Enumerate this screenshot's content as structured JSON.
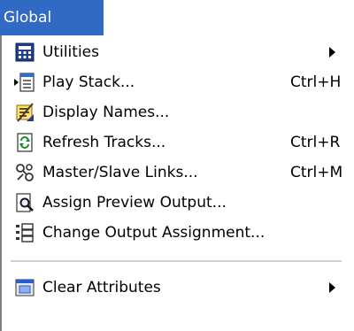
{
  "menu": {
    "title": "Global",
    "accent_color": "#316ac5",
    "items": [
      {
        "icon": "utilities-calculator-icon",
        "label": "Utilities",
        "shortcut": "",
        "has_submenu": true
      },
      {
        "icon": "play-stack-icon",
        "label": "Play Stack...",
        "shortcut": "Ctrl+H",
        "has_submenu": false
      },
      {
        "icon": "display-names-icon",
        "label": "Display Names...",
        "shortcut": "",
        "has_submenu": false
      },
      {
        "icon": "refresh-tracks-icon",
        "label": "Refresh Tracks...",
        "shortcut": "Ctrl+R",
        "has_submenu": false
      },
      {
        "icon": "master-slave-links-icon",
        "label": "Master/Slave Links...",
        "shortcut": "Ctrl+M",
        "has_submenu": false
      },
      {
        "icon": "assign-preview-output-icon",
        "label": "Assign Preview Output...",
        "shortcut": "",
        "has_submenu": false
      },
      {
        "icon": "change-output-assignment-icon",
        "label": "Change Output Assignment...",
        "shortcut": "",
        "has_submenu": false
      },
      {
        "icon": "clear-attributes-icon",
        "label": "Clear Attributes",
        "shortcut": "",
        "has_submenu": true
      }
    ]
  }
}
